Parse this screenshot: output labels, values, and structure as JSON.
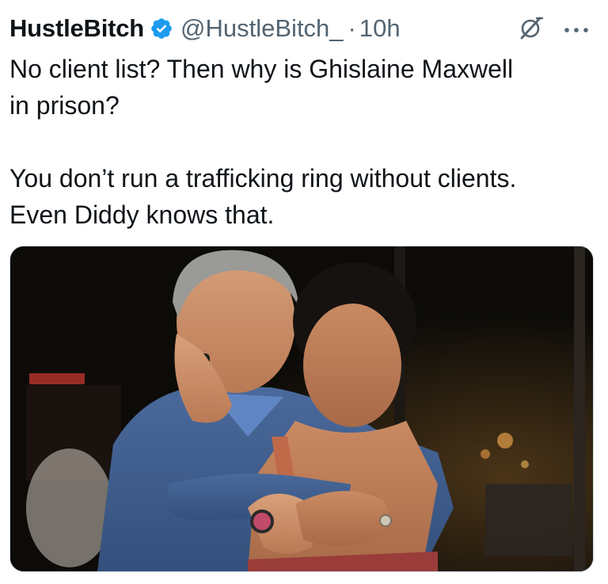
{
  "tweet": {
    "display_name": "HustleBitch",
    "verified": true,
    "handle": "@HustleBitch_",
    "separator": "·",
    "time": "10h",
    "text": "No client list? Then why is Ghislaine Maxwell\nin prison?\n\nYou don’t run a trafficking ring without clients.\nEven Diddy knows that.",
    "icons": {
      "verified": "verified-badge-icon",
      "grok": "grok-icon",
      "more": "more-options-icon"
    },
    "media": {
      "type": "photo",
      "icon": "photo"
    }
  },
  "colors": {
    "text_primary": "#0f1419",
    "text_secondary": "#536471",
    "verified_blue": "#1d9bf0",
    "media_border": "#cfd9de"
  }
}
